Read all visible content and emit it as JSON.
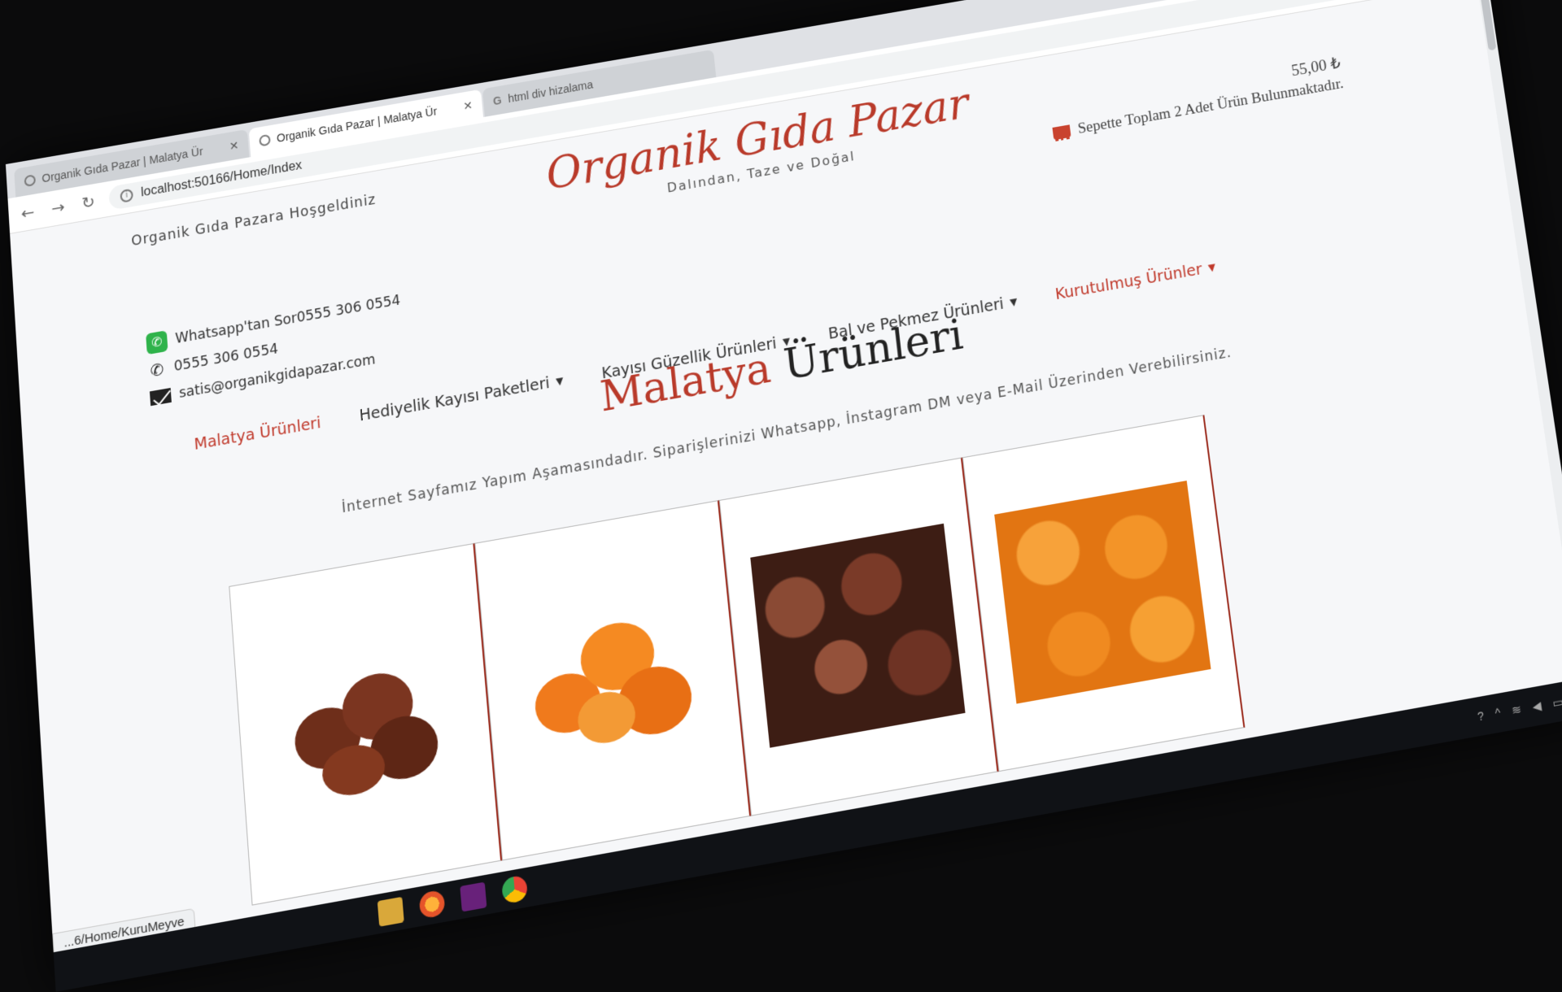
{
  "browser": {
    "tabs": [
      {
        "title": "Organik Gıda Pazar | Malatya Ür",
        "active": false,
        "icon": "globe-icon"
      },
      {
        "title": "Organik Gıda Pazar | Malatya Ür",
        "active": true,
        "icon": "globe-icon"
      },
      {
        "title": "html div hizalama",
        "active": false,
        "icon": "google-icon"
      }
    ],
    "url": "localhost:50166/Home/Index",
    "status_url": "...6/Home/KuruMeyve"
  },
  "header": {
    "welcome": "Organik Gıda Pazara Hoşgeldiniz",
    "brand_title": "Organik Gıda Pazar",
    "brand_subtitle": "Dalından, Taze ve Doğal",
    "cart_total": "55,00 ₺",
    "cart_text": "Sepette Toplam 2 Adet Ürün Bulunmaktadır."
  },
  "contacts": {
    "whatsapp": "Whatsapp'tan Sor0555 306 0554",
    "phone": "0555 306 0554",
    "email": "satis@organikgidapazar.com"
  },
  "nav": {
    "items": [
      {
        "label": "Malatya Ürünleri",
        "active": true,
        "dropdown": false
      },
      {
        "label": "Hediyelik Kayısı Paketleri",
        "active": false,
        "dropdown": true
      },
      {
        "label": "Kayısı Güzellik Ürünleri",
        "active": false,
        "dropdown": true
      },
      {
        "label": "Bal ve Pekmez Ürünleri",
        "active": false,
        "dropdown": true
      },
      {
        "label": "Kurutulmuş Ürünler",
        "active": true,
        "dropdown": true
      }
    ]
  },
  "main": {
    "title_accent": "Malatya",
    "title_rest": "Ürünleri",
    "notice": "İnternet Sayfamız Yapım Aşamasındadır. Siparişlerinizi Whatsapp, İnstagram DM veya E-Mail Üzerinden Verebilirsiniz."
  },
  "products": [
    {
      "image": "dried-brown-apricots-image"
    },
    {
      "image": "dried-orange-apricots-image"
    },
    {
      "image": "sun-dried-apricots-pile-image"
    },
    {
      "image": "orange-apricots-flat-image"
    }
  ],
  "colors": {
    "brand": "#b93a2a",
    "accent_nav": "#c0392b",
    "whatsapp": "#2fb34b"
  }
}
